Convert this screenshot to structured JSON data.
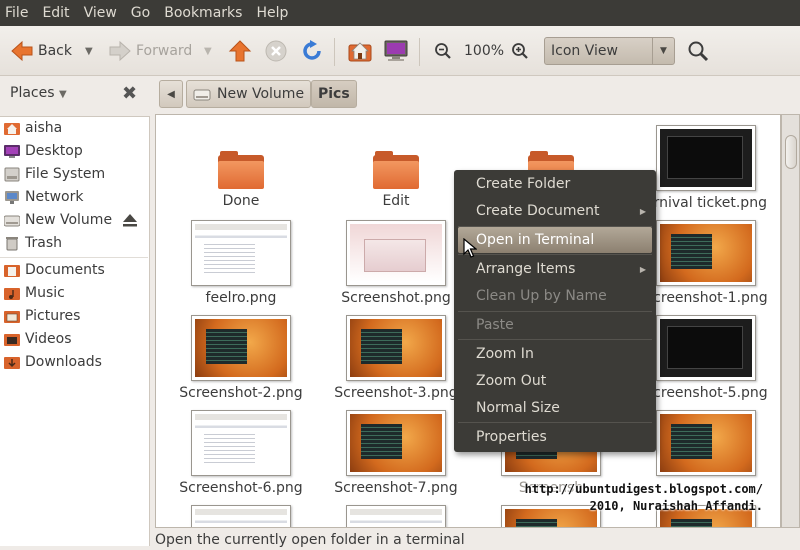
{
  "menubar": [
    "File",
    "Edit",
    "View",
    "Go",
    "Bookmarks",
    "Help"
  ],
  "toolbar": {
    "back_label": "Back",
    "forward_label": "Forward",
    "zoom_level": "100%",
    "view_mode": "Icon View"
  },
  "sidebar": {
    "header": "Places",
    "items": [
      {
        "label": "aisha",
        "icon": "home-folder-icon"
      },
      {
        "label": "Desktop",
        "icon": "desktop-icon"
      },
      {
        "label": "File System",
        "icon": "drive-icon"
      },
      {
        "label": "Network",
        "icon": "network-icon"
      },
      {
        "label": "New Volume",
        "icon": "volume-icon"
      },
      {
        "label": "Trash",
        "icon": "trash-icon"
      },
      {
        "label": "Documents",
        "icon": "folder-icon"
      },
      {
        "label": "Music",
        "icon": "folder-icon"
      },
      {
        "label": "Pictures",
        "icon": "folder-icon"
      },
      {
        "label": "Videos",
        "icon": "folder-icon"
      },
      {
        "label": "Downloads",
        "icon": "folder-icon"
      }
    ]
  },
  "pathbar": {
    "crumbs": [
      "New Volume",
      "Pics"
    ]
  },
  "files": [
    {
      "name": "Done",
      "kind": "folder"
    },
    {
      "name": "Edit",
      "kind": "folder"
    },
    {
      "name": "",
      "kind": "folder"
    },
    {
      "name": "arnival ticket.png",
      "kind": "thumb-dark"
    },
    {
      "name": "feelro.png",
      "kind": "thumb-web"
    },
    {
      "name": "Screenshot.png",
      "kind": "thumb-pink"
    },
    {
      "name": "Screenshot-1.png",
      "kind": "thumb-orange"
    },
    {
      "name": "Screenshot-2.png",
      "kind": "thumb-orange"
    },
    {
      "name": "Screenshot-3.png",
      "kind": "thumb-orange"
    },
    {
      "name": "Screenshot-5.png",
      "kind": "thumb-dark"
    },
    {
      "name": "Screenshot-6.png",
      "kind": "thumb-web"
    },
    {
      "name": "Screenshot-7.png",
      "kind": "thumb-orange"
    },
    {
      "name": "Screensh",
      "kind": "thumb-orange"
    },
    {
      "name": "",
      "kind": "thumb-orange"
    }
  ],
  "context_menu": {
    "items": [
      {
        "label": "Create Folder",
        "disabled": false,
        "submenu": false,
        "active": false
      },
      {
        "label": "Create Document",
        "disabled": false,
        "submenu": true,
        "active": false
      },
      {
        "label": "Open in Terminal",
        "disabled": false,
        "submenu": false,
        "active": true
      },
      {
        "label": "Arrange Items",
        "disabled": false,
        "submenu": true,
        "active": false
      },
      {
        "label": "Clean Up by Name",
        "disabled": true,
        "submenu": false,
        "active": false
      },
      {
        "label": "Paste",
        "disabled": true,
        "submenu": false,
        "active": false
      },
      {
        "label": "Zoom In",
        "disabled": false,
        "submenu": false,
        "active": false
      },
      {
        "label": "Zoom Out",
        "disabled": false,
        "submenu": false,
        "active": false
      },
      {
        "label": "Normal Size",
        "disabled": false,
        "submenu": false,
        "active": false
      },
      {
        "label": "Properties",
        "disabled": false,
        "submenu": false,
        "active": false
      }
    ]
  },
  "watermark": {
    "line1": "http://ubuntudigest.blogspot.com/",
    "line2": "2010, Nuraishah Affandi."
  },
  "status": "Open the currently open folder in a terminal",
  "colors": {
    "menubar_bg": "#3c3b37",
    "menu_bg": "#3c3b37",
    "menu_highlight": "#a0958a",
    "folder_orange": "#e06a32",
    "window_bg": "#efebe7"
  }
}
